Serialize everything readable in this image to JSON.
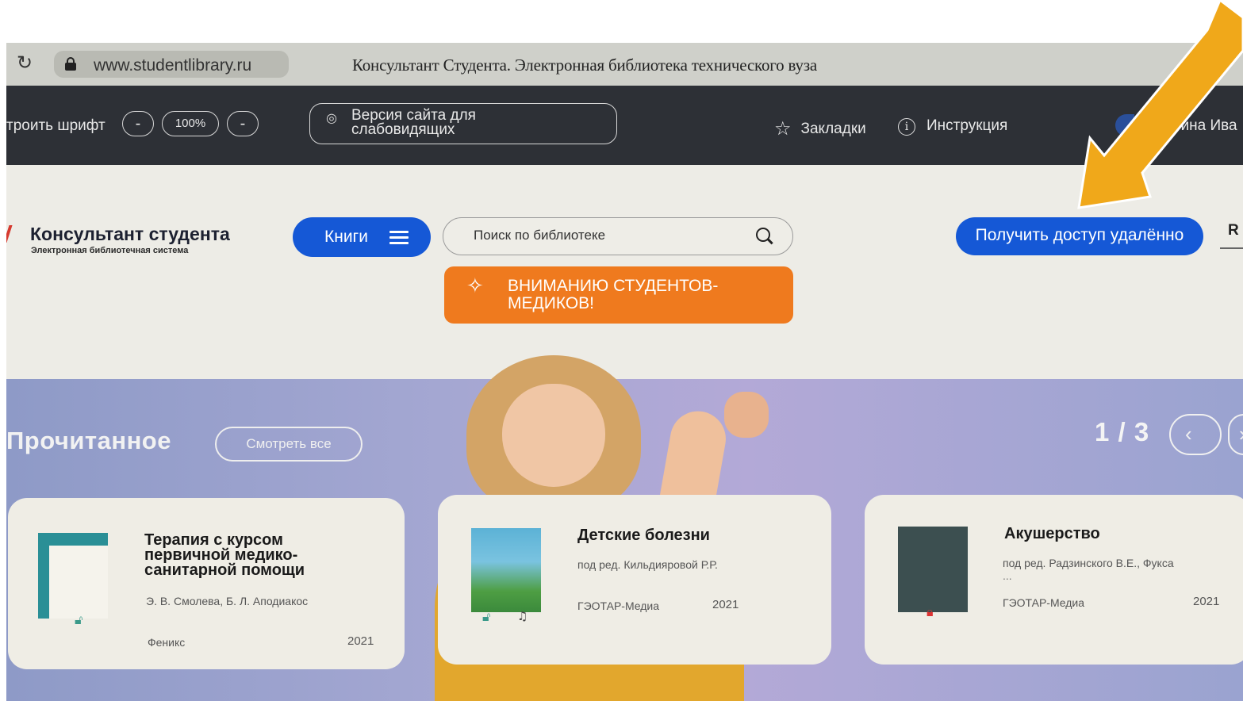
{
  "browser": {
    "url": "www.studentlibrary.ru",
    "page_title": "Консультант Студента. Электронная библиотека технического вуза"
  },
  "accessibility": {
    "font_label": "троить шрифт",
    "font_minus": "-",
    "font_zoom": "100%",
    "font_plus": "-",
    "low_vision_label": "Версия сайта для слабовидящих"
  },
  "top_nav": {
    "bookmarks": "Закладки",
    "instructions": "Инструкция",
    "user_name": "рина Ива"
  },
  "header": {
    "logo_title": "Консультант студента",
    "logo_subtitle": "Электронная библиотечная система",
    "books_button": "Книги",
    "search_placeholder": "Поиск по библиотеке",
    "notice_button": "ВНИМАНИЮ СТУДЕНТОВ-МЕДИКОВ!",
    "remote_access_button": "Получить доступ удалённо",
    "language": "R"
  },
  "recent": {
    "title": "Прочитанное",
    "view_all": "Смотреть все",
    "pager": "1 / 3",
    "prev": "‹",
    "next": "›",
    "books": [
      {
        "title": "Терапия с курсом первичной медико-санитарной помощи",
        "authors": "Э. В. Смолева, Б. Л. Аподиакос",
        "publisher": "Феникс",
        "year": "2021"
      },
      {
        "title": "Детские болезни",
        "authors": "под ред. Кильдияровой Р.Р.",
        "publisher": "ГЭОТАР-Медиа",
        "year": "2021"
      },
      {
        "title": "Акушерство",
        "authors": "под ред. Радзинского В.Е., Фукса",
        "dots": "...",
        "publisher": "ГЭОТАР-Медиа",
        "year": "2021"
      }
    ]
  },
  "colors": {
    "primary_blue": "#1558d6",
    "notice_orange": "#ef7a1e",
    "dark_bar": "#2d3036",
    "arrow": "#f0a81a"
  },
  "icons": [
    "reload-icon",
    "lock-icon",
    "eye-icon",
    "star-icon",
    "info-icon",
    "menu-icon",
    "search-icon",
    "sparkle-icon",
    "lock-small-icon",
    "audio-icon",
    "chevron-left-icon",
    "chevron-right-icon"
  ]
}
